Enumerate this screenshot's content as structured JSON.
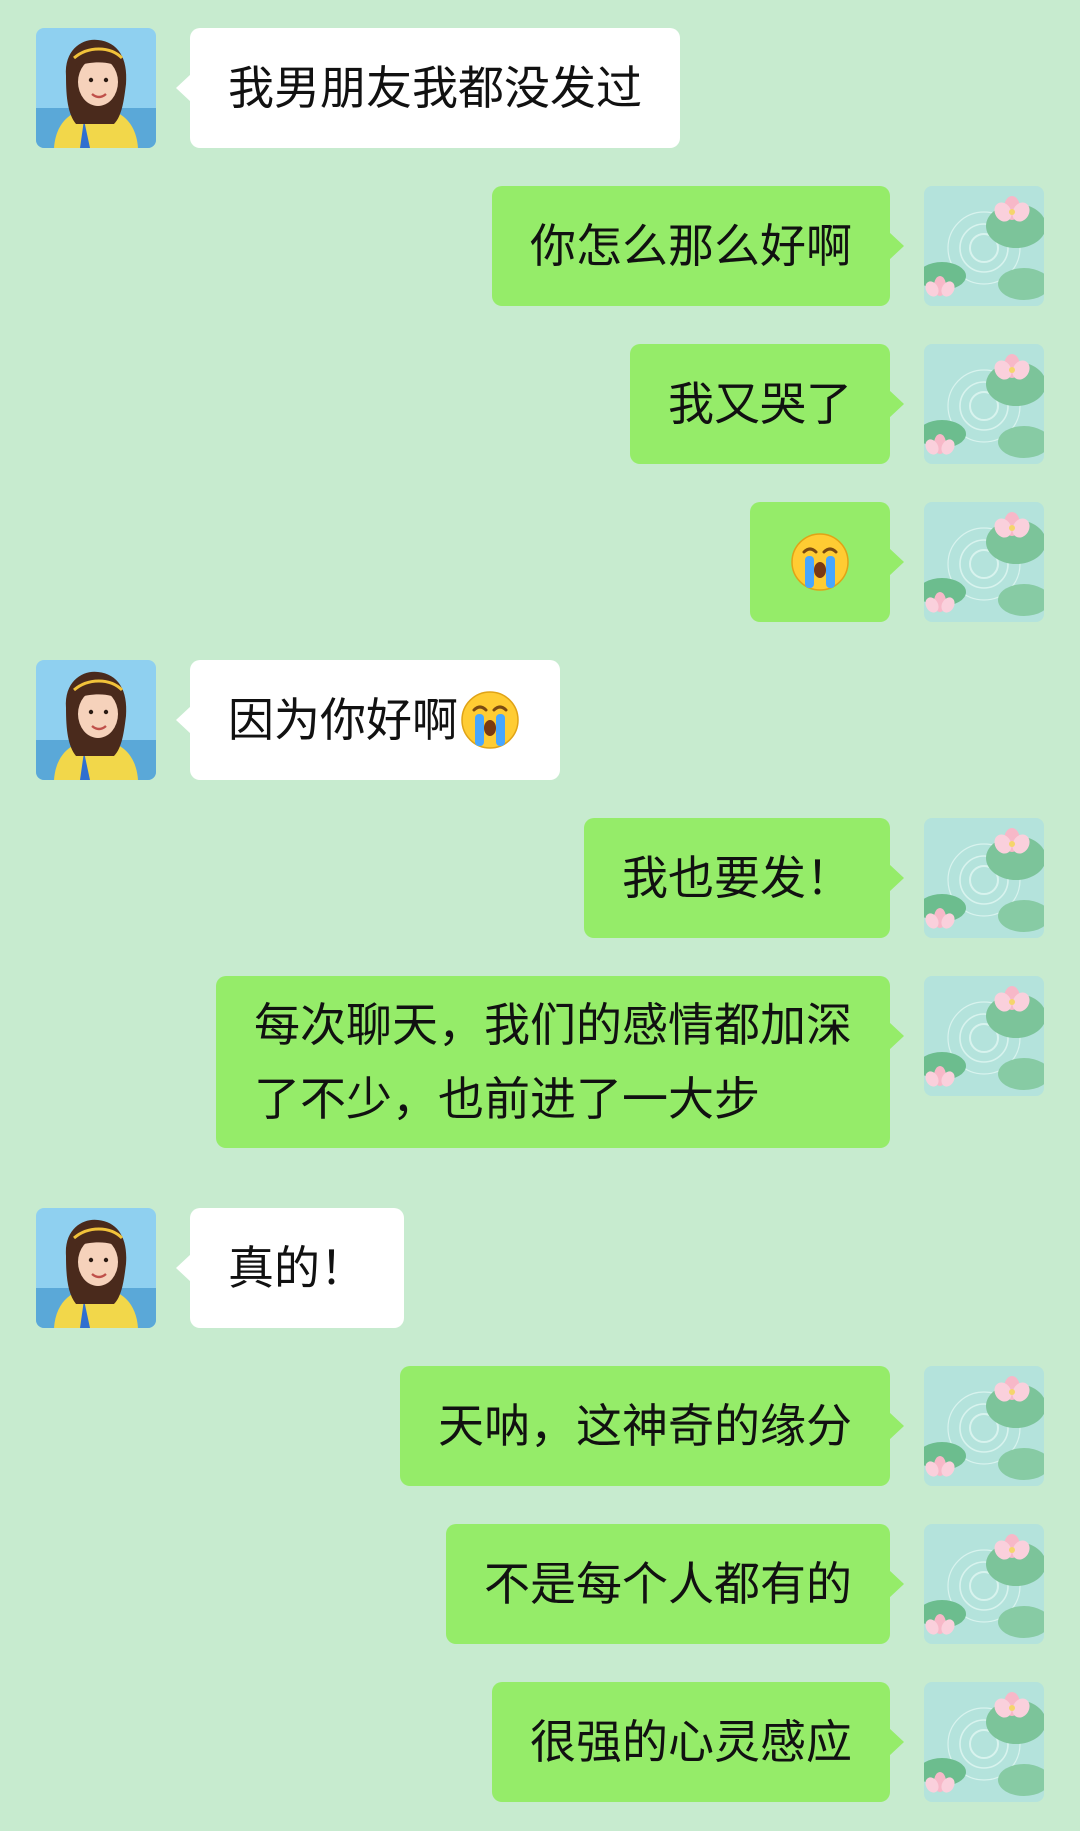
{
  "conversation": {
    "messages": [
      {
        "id": 1,
        "side": "in",
        "text": "我男朋友我都没发过"
      },
      {
        "id": 2,
        "side": "out",
        "text": "你怎么那么好啊"
      },
      {
        "id": 3,
        "side": "out",
        "text": "我又哭了"
      },
      {
        "id": 4,
        "side": "out",
        "text": "",
        "emoji": "crying-face-emoji"
      },
      {
        "id": 5,
        "side": "in",
        "text": "因为你好啊",
        "emoji": "crying-face-emoji"
      },
      {
        "id": 6,
        "side": "out",
        "text": "我也要发！"
      },
      {
        "id": 7,
        "side": "out",
        "lines": [
          "每次聊天，我们的感情都加深",
          "了不少，也前进了一大步"
        ]
      },
      {
        "id": 8,
        "side": "in",
        "text": "真的！"
      },
      {
        "id": 9,
        "side": "out",
        "text": "天呐，这神奇的缘分"
      },
      {
        "id": 10,
        "side": "out",
        "text": "不是每个人都有的"
      },
      {
        "id": 11,
        "side": "out",
        "text": "很强的心灵感应"
      }
    ]
  },
  "avatars": {
    "contact": "girl-portrait-avatar",
    "self": "lotus-pond-avatar"
  },
  "colors": {
    "background": "#c7ebcf",
    "incoming_bubble": "#ffffff",
    "outgoing_bubble": "#95ec69"
  }
}
